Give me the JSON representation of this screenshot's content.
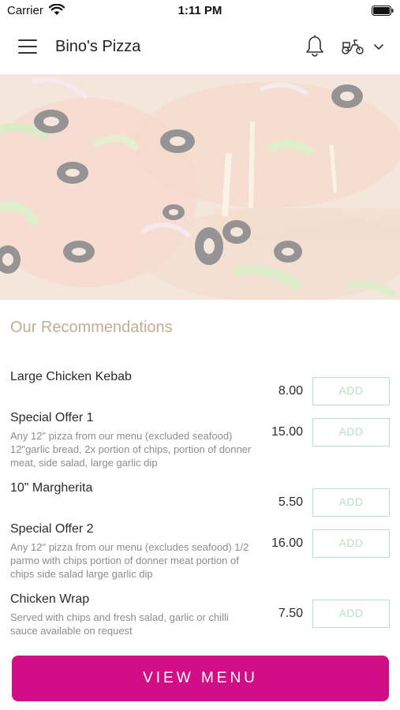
{
  "status_bar": {
    "carrier": "Carrier",
    "time": "1:11 PM"
  },
  "header": {
    "title": "Bino's Pizza",
    "icons": [
      "menu-icon",
      "bell-icon",
      "scooter-icon",
      "chevron-down-icon"
    ]
  },
  "hero": {
    "image": "pizza-photo"
  },
  "recommendations": {
    "title": "Our Recommendations",
    "items": [
      {
        "name": "Large Chicken Kebab",
        "description": "",
        "price": "8.00",
        "add_label": "ADD"
      },
      {
        "name": "Special Offer 1",
        "description": "Any 12\" pizza from our menu (excluded seafood) 12\"garlic bread, 2x portion of chips, portion of donner meat, side salad, large garlic dip",
        "price": "15.00",
        "add_label": "ADD"
      },
      {
        "name": "10\" Margherita",
        "description": "",
        "price": "5.50",
        "add_label": "ADD"
      },
      {
        "name": "Special Offer 2",
        "description": "Any 12\" pizza from our menu (excludes seafood) 1/2 parmo with chips portion of donner meat portion of chips side salad large garlic dip",
        "price": "16.00",
        "add_label": "ADD"
      },
      {
        "name": "Chicken Wrap",
        "description": "Served with chips and fresh salad, garlic or chilli sauce available on request",
        "price": "7.50",
        "add_label": "ADD"
      }
    ]
  },
  "footer": {
    "view_menu_label": "VIEW MENU"
  },
  "colors": {
    "primary": "#d10e86",
    "add_button_border": "#b7e1c8",
    "section_title": "#c2ad92"
  }
}
